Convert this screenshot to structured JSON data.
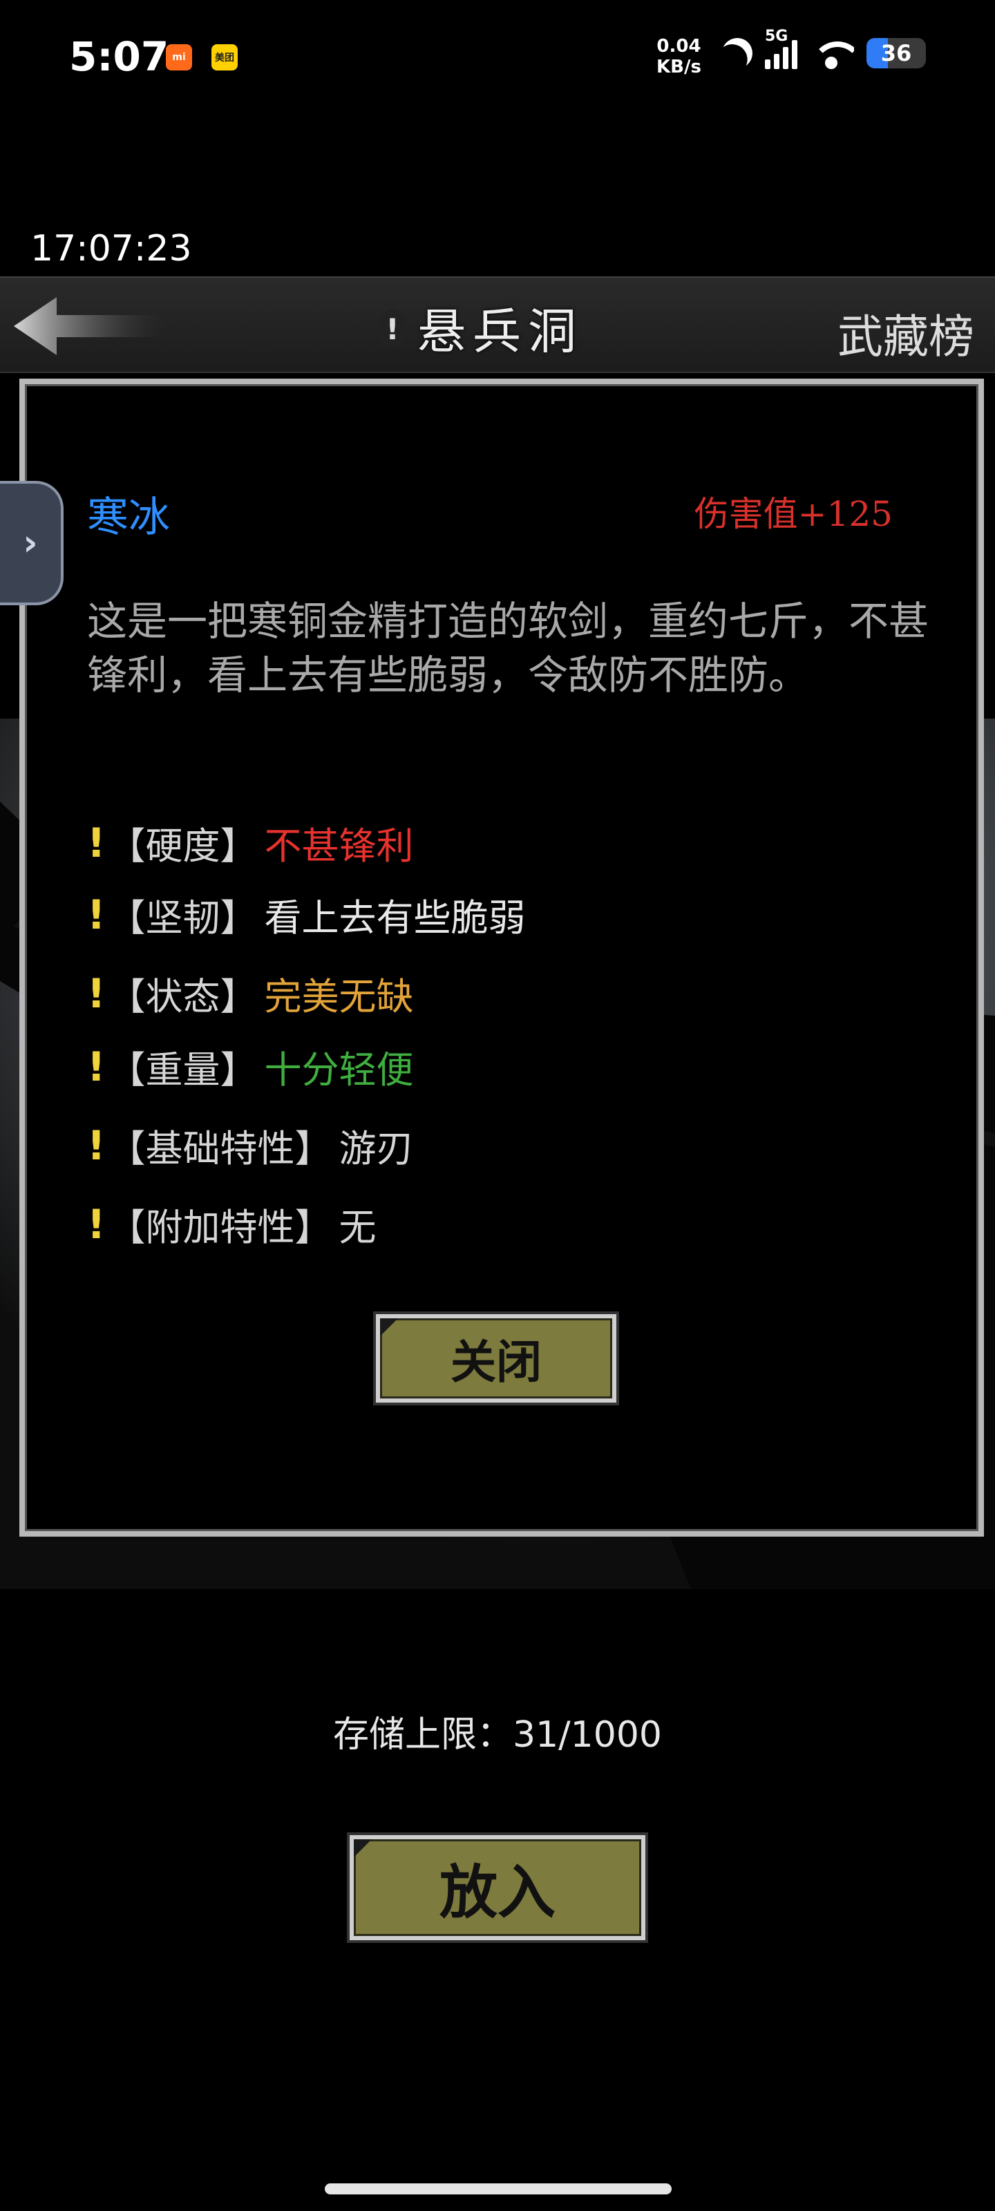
{
  "status_bar": {
    "time": "5:07",
    "app_icons": [
      "mi",
      "美团"
    ],
    "net_speed_value": "0.04",
    "net_speed_unit": "KB/s",
    "network_type": "5G",
    "battery_level": "36"
  },
  "clock": "17:07:23",
  "nav": {
    "title": "悬兵洞",
    "title_mark": "!",
    "right_link": "武藏榜"
  },
  "item": {
    "name": "寒冰",
    "damage": "伤害值+125",
    "description": "这是一把寒铜金精打造的软剑，重约七斤，不甚锋利，看上去有些脆弱，令敌防不胜防。",
    "attributes": [
      {
        "bang": "!",
        "key": "【硬度】",
        "value": "不甚锋利",
        "color": "#e8322e"
      },
      {
        "bang": "!",
        "key": "【坚韧】",
        "value": "看上去有些脆弱",
        "color": "#e8e8e8"
      },
      {
        "bang": "!",
        "key": "【状态】",
        "value": "完美无缺",
        "color": "#e2a33a"
      },
      {
        "bang": "!",
        "key": "【重量】",
        "value": "十分轻便",
        "color": "#3fae3f"
      },
      {
        "bang": "!",
        "key": "【基础特性】",
        "value": "游刃",
        "color": "#d6d6d6"
      },
      {
        "bang": "!",
        "key": "【附加特性】",
        "value": "无",
        "color": "#d6d6d6"
      }
    ]
  },
  "buttons": {
    "close": "关闭",
    "put_in": "放入"
  },
  "side_tab_icon": "chevron-right-icon",
  "storage_label": "存储上限：31/1000"
}
